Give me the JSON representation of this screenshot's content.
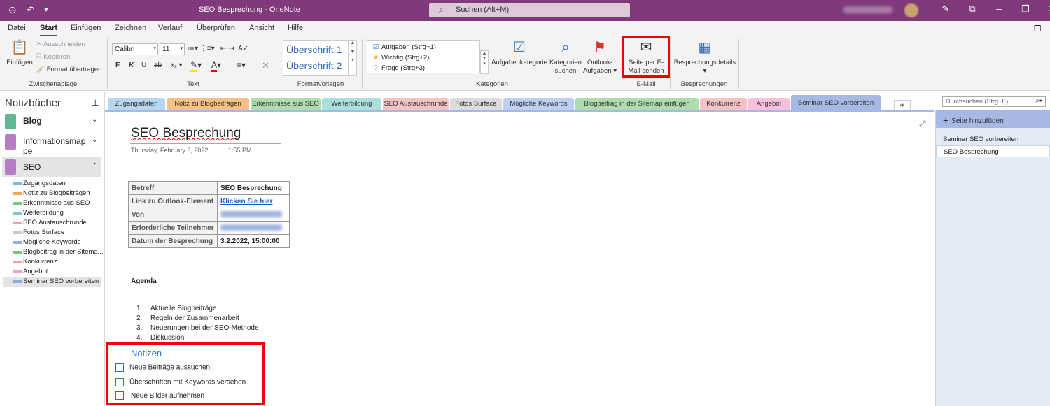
{
  "titlebar": {
    "title": "SEO Besprechung  -  OneNote",
    "search_placeholder": "Suchen (Alt+M)",
    "back_icon": "back-icon",
    "undo_icon": "undo-icon"
  },
  "menu": {
    "tabs": [
      "Datei",
      "Start",
      "Einfügen",
      "Zeichnen",
      "Verlauf",
      "Überprüfen",
      "Ansicht",
      "Hilfe"
    ],
    "active": "Start"
  },
  "ribbon": {
    "clipboard": {
      "paste": "Einfügen",
      "cut": "Ausschneiden",
      "copy": "Kopieren",
      "format_painter": "Format übertragen",
      "label": "Zwischenablage"
    },
    "text": {
      "font": "Calibri",
      "size": "11",
      "bold": "F",
      "italic": "K",
      "underline": "U",
      "strike": "ab",
      "label": "Text"
    },
    "styles": {
      "h1": "Überschrift 1",
      "h2": "Überschrift 2",
      "label": "Formatvorlagen"
    },
    "tags": {
      "items": [
        "Aufgaben (Strg+1)",
        "Wichtig (Strg+2)",
        "Frage (Strg+3)"
      ],
      "task_tag": "Aufgabenkategorie",
      "find_tags": "Kategorien suchen",
      "outlook_tasks": "Outlook-Aufgaben",
      "label": "Kategorien"
    },
    "email": {
      "send": "Seite per E-Mail senden",
      "label": "E-Mail"
    },
    "meetings": {
      "details": "Besprechungsdetails",
      "label": "Besprechungen"
    }
  },
  "notebooks": {
    "title": "Notizbücher",
    "items": [
      {
        "name": "Blog",
        "color": "#5fb894"
      },
      {
        "name": "Informationsmappe",
        "color": "#b77dc4"
      },
      {
        "name": "SEO",
        "color": "#b77dc4"
      }
    ],
    "sections": [
      {
        "name": "Zugangsdaten",
        "color": "#7fb8e0"
      },
      {
        "name": "Notiz zu Blogbeiträgen",
        "color": "#f2a65a"
      },
      {
        "name": "Erkenntnisse aus SEO",
        "color": "#7cc77f"
      },
      {
        "name": "Weiterbildung",
        "color": "#7bc9c6"
      },
      {
        "name": "SEO Austauschrunde",
        "color": "#f0a0a8"
      },
      {
        "name": "Fotos Surface",
        "color": "#c9c9c9"
      },
      {
        "name": "Mögliche Keywords",
        "color": "#8fb0e6"
      },
      {
        "name": "Blogbeitrag in der Sitema...",
        "color": "#7cc77f"
      },
      {
        "name": "Konkurrenz",
        "color": "#f0a0a8"
      },
      {
        "name": "Angebot",
        "color": "#f0a0c8"
      },
      {
        "name": "Seminar SEO vorbereiten",
        "color": "#8fa8e0"
      }
    ]
  },
  "section_tabs": [
    {
      "name": "Zugangsdaten",
      "color": "#b7d7ef"
    },
    {
      "name": "Notiz zu Blogbeiträgen",
      "color": "#f6c08a"
    },
    {
      "name": "Erkenntnisse aus SEO",
      "color": "#aedcaf"
    },
    {
      "name": "Weiterbildung",
      "color": "#a9dfdc"
    },
    {
      "name": "SEO Austauschrunde",
      "color": "#f4c2c7"
    },
    {
      "name": "Fotos Surface",
      "color": "#dcdcdc"
    },
    {
      "name": "Mögliche Keywords",
      "color": "#bcd0f1"
    },
    {
      "name": "Blogbeitrag in der Sitemap einfügen",
      "color": "#aedcaf"
    },
    {
      "name": "Konkurrenz",
      "color": "#f4c2c7"
    },
    {
      "name": "Angebot",
      "color": "#f6c1dc"
    },
    {
      "name": "Seminar SEO vorbereiten",
      "color": "#a6b9e5"
    }
  ],
  "search": {
    "placeholder": "Durchsuchen (Strg+E)"
  },
  "page": {
    "title": "SEO Besprechung",
    "date": "Thursday, February 3, 2022",
    "time": "1:55 PM",
    "meeting_table": [
      {
        "key": "Betreff",
        "value": "SEO Besprechung"
      },
      {
        "key": "Link zu Outlook-Element",
        "value": "Klicken Sie hier"
      },
      {
        "key": "Von",
        "value": ""
      },
      {
        "key": "Erforderliche Teilnehmer",
        "value": ""
      },
      {
        "key": "Datum der Besprechung",
        "value": "3.2.2022, 15:00:00"
      }
    ],
    "agenda_title": "Agenda",
    "agenda": [
      "Aktuelle Blogbeiträge",
      "Regeln der Zusammenarbeit",
      "Neuerungen bei der SEO-Methode",
      "Diskussion"
    ],
    "notes_title": "Notizen",
    "todos": [
      "Neue Beiträge aussuchen",
      "Überschriften mit Keywords versehen",
      "Neue Bilder aufnehmen"
    ]
  },
  "pages_panel": {
    "add_page": "Seite hinzufügen",
    "pages": [
      "Seminar SEO vorbereiten",
      "SEO Besprechung"
    ]
  }
}
